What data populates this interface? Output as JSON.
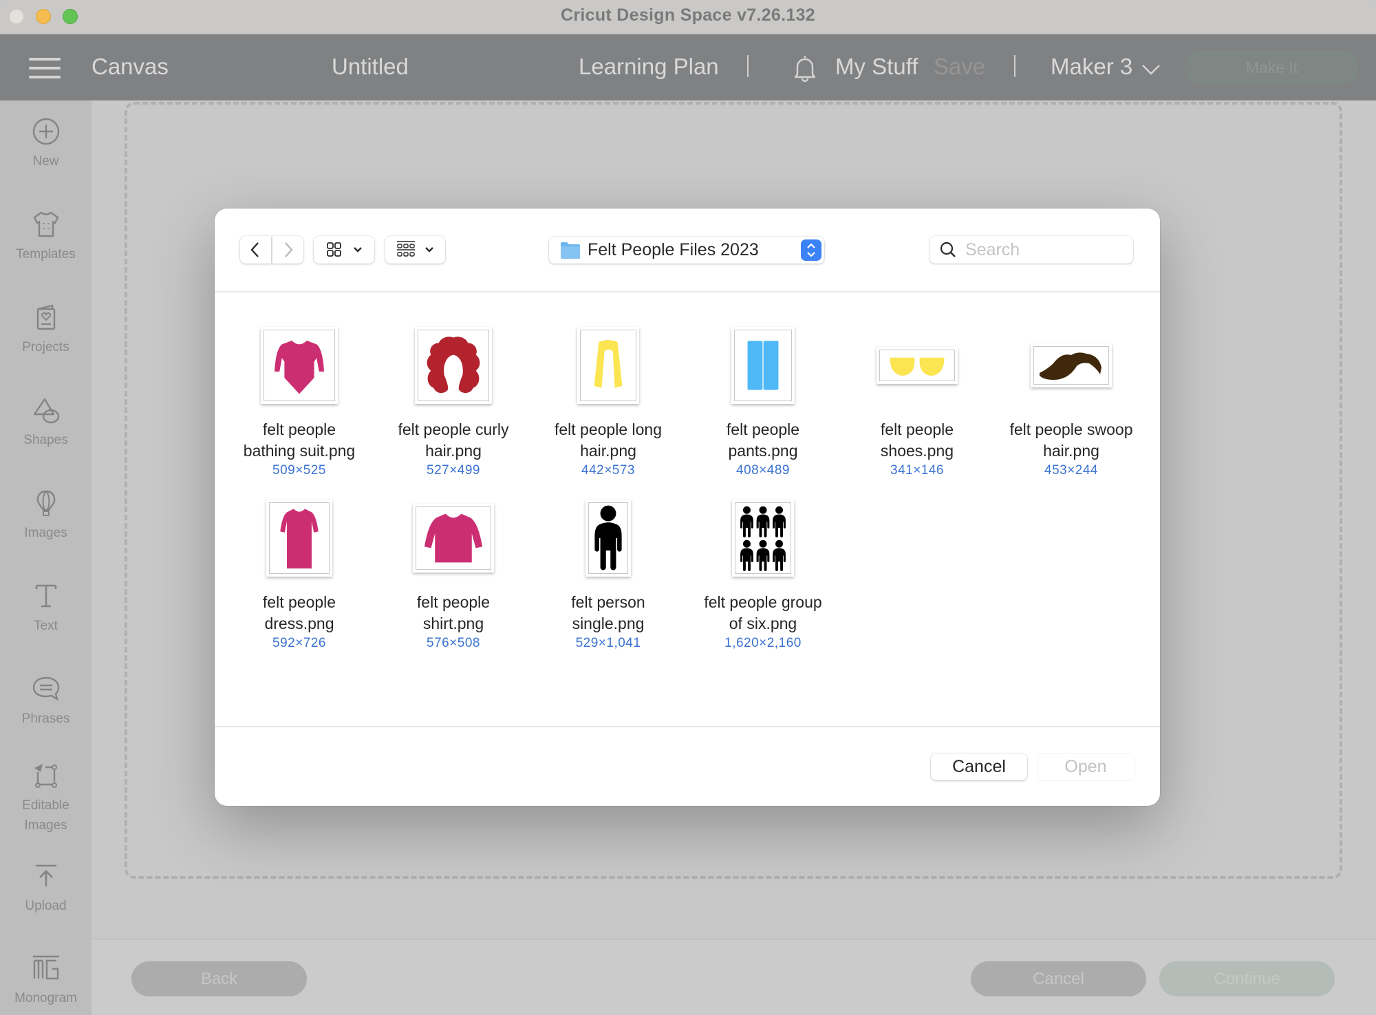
{
  "window": {
    "title": "Cricut Design Space  v7.26.132"
  },
  "header": {
    "canvas_label": "Canvas",
    "project_name": "Untitled",
    "learning_plan": "Learning Plan",
    "my_stuff": "My Stuff",
    "save": "Save",
    "machine": "Maker 3",
    "make_it": "Make It"
  },
  "sidebar": {
    "items": [
      {
        "label": "New",
        "icon": "plus-circle-icon"
      },
      {
        "label": "Templates",
        "icon": "tshirt-icon"
      },
      {
        "label": "Projects",
        "icon": "project-card-icon"
      },
      {
        "label": "Shapes",
        "icon": "shapes-icon"
      },
      {
        "label": "Images",
        "icon": "balloon-icon"
      },
      {
        "label": "Text",
        "icon": "text-t-icon"
      },
      {
        "label": "Phrases",
        "icon": "speech-bubble-icon"
      },
      {
        "label": "Editable Images",
        "icon": "editable-image-icon"
      },
      {
        "label": "Upload",
        "icon": "upload-icon"
      },
      {
        "label": "Monogram",
        "icon": "monogram-icon"
      }
    ]
  },
  "footer": {
    "back": "Back",
    "cancel": "Cancel",
    "continue": "Continue"
  },
  "dialog": {
    "folder": "Felt People Files 2023",
    "search_placeholder": "Search",
    "search_value": "",
    "cancel": "Cancel",
    "open": "Open",
    "files": [
      {
        "name": "felt people bathing suit.png",
        "line1": "felt people",
        "line2": "bathing suit.png",
        "dims": "509×525",
        "color": "#cc2e72",
        "shape": "bathing-suit"
      },
      {
        "name": "felt people curly hair.png",
        "line1": "felt people curly",
        "line2": "hair.png",
        "dims": "527×499",
        "color": "#b3232e",
        "shape": "curly-hair"
      },
      {
        "name": "felt people long hair.png",
        "line1": "felt people long",
        "line2": "hair.png",
        "dims": "442×573",
        "color": "#fbe551",
        "shape": "long-hair"
      },
      {
        "name": "felt people pants.png",
        "line1": "felt people",
        "line2": "pants.png",
        "dims": "408×489",
        "color": "#4fb8f7",
        "shape": "pants"
      },
      {
        "name": "felt people shoes.png",
        "line1": "felt people",
        "line2": "shoes.png",
        "dims": "341×146",
        "color": "#fbe551",
        "shape": "shoes"
      },
      {
        "name": "felt people swoop hair.png",
        "line1": "felt people swoop",
        "line2": "hair.png",
        "dims": "453×244",
        "color": "#3f280b",
        "shape": "swoop-hair"
      },
      {
        "name": "felt people dress.png",
        "line1": "felt people",
        "line2": "dress.png",
        "dims": "592×726",
        "color": "#cc2e72",
        "shape": "dress"
      },
      {
        "name": "felt people shirt.png",
        "line1": "felt people",
        "line2": "shirt.png",
        "dims": "576×508",
        "color": "#cc2e72",
        "shape": "shirt"
      },
      {
        "name": "felt person single.png",
        "line1": "felt person",
        "line2": "single.png",
        "dims": "529×1,041",
        "color": "#000000",
        "shape": "person"
      },
      {
        "name": "felt people group of six.png",
        "line1": "felt people group",
        "line2": "of six.png",
        "dims": "1,620×2,160",
        "color": "#000000",
        "shape": "group-of-six"
      }
    ]
  }
}
